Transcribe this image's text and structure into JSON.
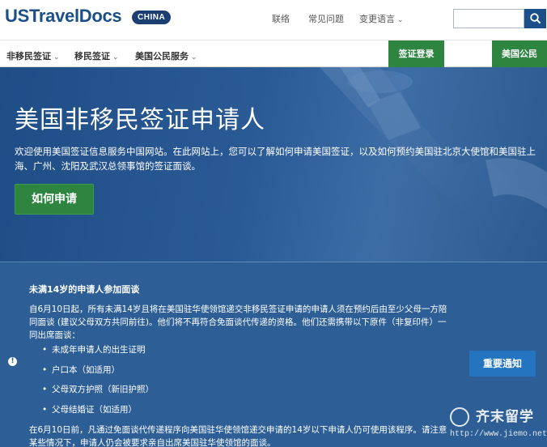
{
  "header": {
    "logo_text": "USTravelDocs",
    "logo_badge": "CHINA",
    "links": [
      "联络",
      "常见问题",
      "变更语言"
    ],
    "search_input_value": ""
  },
  "nav": {
    "items": [
      {
        "label": "非移民签证"
      },
      {
        "label": "移民签证"
      },
      {
        "label": "美国公民服务"
      }
    ],
    "visa_login_label": "签证登录",
    "citizen_label": "美国公民"
  },
  "hero": {
    "title": "美国非移民签证申请人",
    "text": "欢迎使用美国签证信息服务中国网站。在此网站上，您可以了解如何申请美国签证，以及如何预约美国驻北京大使馆和美国驻上海、广州、沈阳及武汉总领事馆的签证面谈。",
    "button_label": "如何申请"
  },
  "alert": {
    "icon_glyph": "!",
    "title": "未满14岁的申请人参加面谈",
    "paragraph1": "自6月10日起，所有未满14岁且将在美国驻华使领馆递交非移民签证申请的申请人须在预约后由至少父母一方陪同面谈 (建议父母双方共同前往)。他们将不再符合免面谈代传递的资格。他们还需携带以下原件（非复印件）一同出席面谈：",
    "list": [
      "未成年申请人的出生证明",
      "户口本（如适用）",
      "父母双方护照（新旧护照）",
      "父母结婚证（如适用）"
    ],
    "paragraph2": "在6月10日前，凡通过免面谈代传递程序向美国驻华使领馆递交申请的14岁以下申请人仍可使用该程序。请注意某些情况下，申请人仍会被要求亲自出席美国驻华使领馆的面谈。",
    "button_label": "重要通知"
  },
  "watermark": {
    "brand": "齐末留学",
    "url": "http://www.jiemo.net"
  },
  "colors": {
    "brand_blue": "#1b4f8a",
    "green": "#2e8540",
    "alert_blue": "#2d5f96",
    "notice_blue": "#2474c0"
  }
}
